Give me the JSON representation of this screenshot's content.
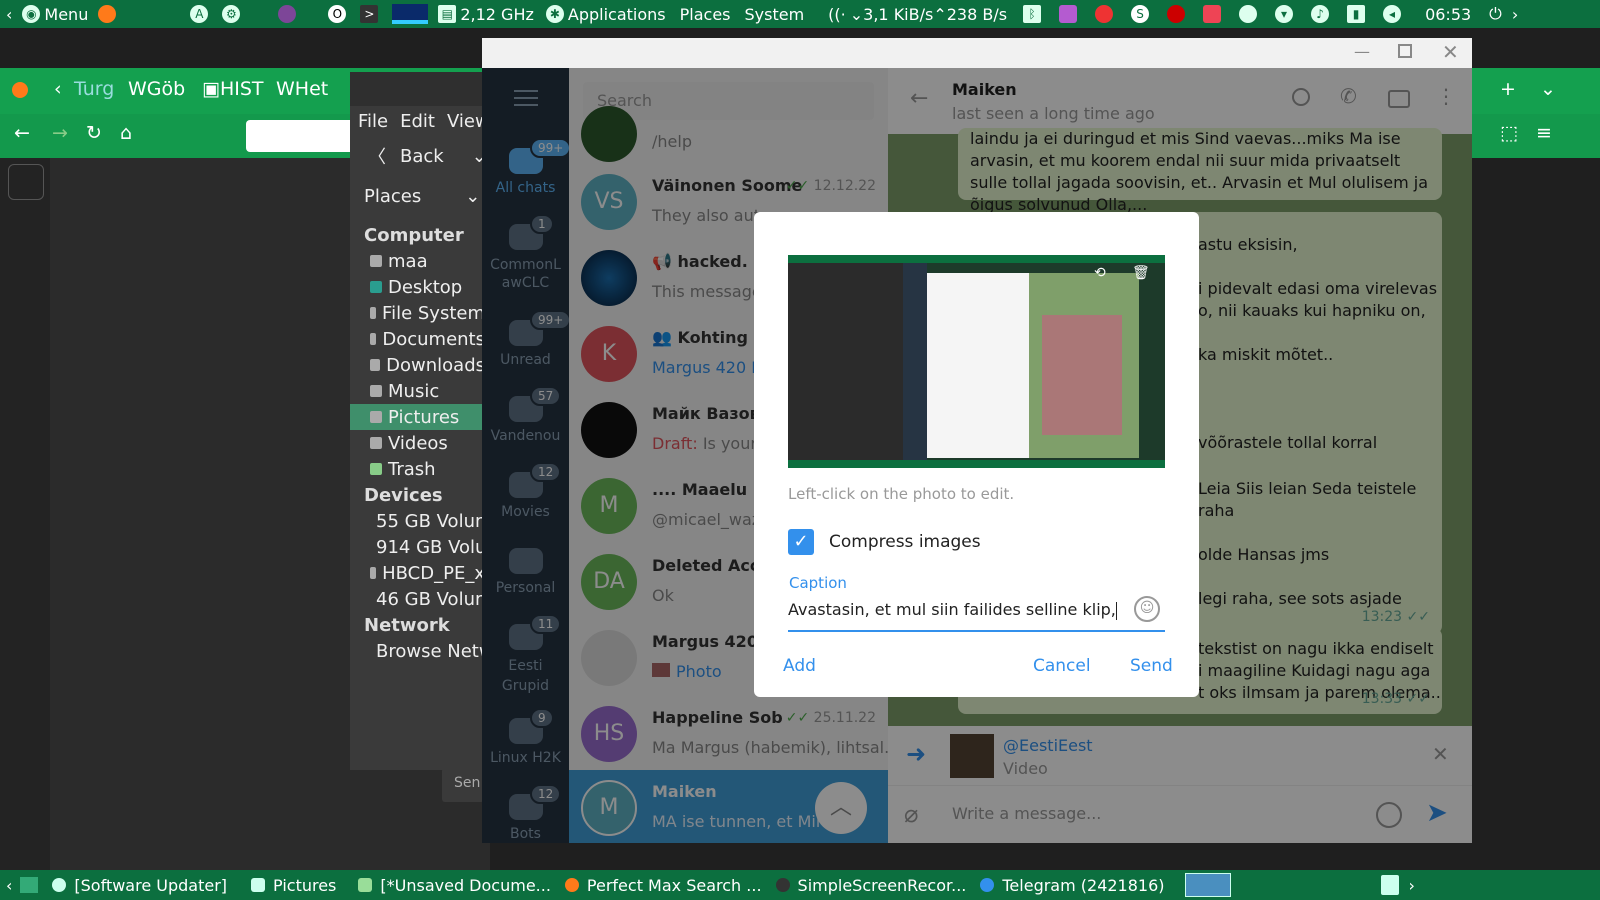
{
  "top_panel": {
    "menu_label": "Menu",
    "cpu_freq": "2,12 GHz",
    "applications": "Applications",
    "places": "Places",
    "system": "System",
    "net_down": "3,1 KiB/s",
    "net_up": "238 B/s",
    "clock": "06:53"
  },
  "firefox": {
    "tabs": [
      "Turg",
      "Göb",
      "HIST",
      "Het"
    ]
  },
  "file_manager": {
    "menu": [
      "File",
      "Edit",
      "View"
    ],
    "back_label": "Back",
    "places_label": "Places",
    "sections": [
      {
        "title": "Computer",
        "items": [
          "maa",
          "Desktop",
          "File System",
          "Documents",
          "Downloads",
          "Music",
          "Pictures",
          "Videos",
          "Trash"
        ]
      },
      {
        "title": "Devices",
        "items": [
          "55 GB Volume",
          "914 GB Volume",
          "HBCD_PE_x",
          "46 GB Volume"
        ]
      },
      {
        "title": "Network",
        "items": [
          "Browse Network"
        ]
      }
    ],
    "selected": "Pictures",
    "bottom_fragment": "Sen"
  },
  "telegram": {
    "search_placeholder": "Search",
    "folders": [
      {
        "label": "All chats",
        "badge": "99+"
      },
      {
        "label": "CommonLawCLC",
        "badge": "1"
      },
      {
        "label": "Unread",
        "badge": "99+"
      },
      {
        "label": "Vandenou",
        "badge": "57"
      },
      {
        "label": "Movies",
        "badge": "12"
      },
      {
        "label": "Personal",
        "badge": ""
      },
      {
        "label": "Eesti Grupid",
        "badge": "11"
      },
      {
        "label": "Linux H2K",
        "badge": "9"
      },
      {
        "label": "Bots",
        "badge": "12"
      }
    ],
    "chats": [
      {
        "initials": "",
        "name": "",
        "preview": "/help",
        "date": "",
        "color": "#2d5a2d"
      },
      {
        "initials": "VS",
        "name": "Väinonen Soome",
        "preview": "They also auto",
        "date": "12.12.22",
        "color": "#5fb3c5"
      },
      {
        "initials": "",
        "name": "hacked.",
        "preview": "This message",
        "date": "",
        "color": "#0b2a4a"
      },
      {
        "initials": "K",
        "name": "Kohting",
        "preview": "Margus 420 M",
        "date": "",
        "color": "#e0555d"
      },
      {
        "initials": "",
        "name": "Майк Вазовс",
        "preview": "Is your",
        "draft": "Draft:",
        "date": "",
        "color": "#222"
      },
      {
        "initials": "M",
        "name": ".... Maaelu",
        "preview": "@micael_waz",
        "date": "",
        "color": "#6cbb5c"
      },
      {
        "initials": "DA",
        "name": "Deleted Accou",
        "preview": "Ok",
        "date": "",
        "color": "#6cbb5c"
      },
      {
        "initials": "",
        "name": "Margus 420 M",
        "preview": "Photo",
        "date": "",
        "color": "#ddd"
      },
      {
        "initials": "HS",
        "name": "Happeline Sob",
        "preview": "Ma Margus (habemik), lihtsal...",
        "date": "25.11.22",
        "color": "#9a6ecf"
      },
      {
        "initials": "M",
        "name": "Maiken",
        "preview": "MA ise tunnen, et Ming",
        "date": "",
        "color": "#5fb3c5"
      }
    ],
    "chat_header": {
      "name": "Maiken",
      "status": "last seen a long time ago"
    },
    "messages": [
      "laindu ja ei duringud et mis Sind vaevas...miks Ma ise arvasin, et mu koorem endal nii suur mida privaatselt sulle tollal jagada soovisin, et.. Arvasin et Mul olulisem ja õigus solvunud Olla,...",
      "astu eksisin,",
      "i pidevalt edasi oma virelevas",
      "o, nii kauaks kui hapniku on,",
      "ka miskit mõtet..",
      "võõrastele tollal korral",
      "Leia Siis leian Seda teistele raha",
      "olde Hansas jms",
      "legi raha, see sots asjade",
      "tekstist on nagu ikka endiselt",
      "i maagiline Kuidagi nagu aga",
      "t oks ilmsam ja parem olema.."
    ],
    "msg_times": [
      "13:23",
      "13:33"
    ],
    "reply": {
      "from": "@EestiEest",
      "type": "Video"
    },
    "input_placeholder": "Write a message..."
  },
  "dialog": {
    "hint": "Left-click on the photo to edit.",
    "compress_label": "Compress images",
    "compress_checked": true,
    "caption_label": "Caption",
    "caption_value": "Avastasin, et mul siin failides selline klip,",
    "add": "Add",
    "cancel": "Cancel",
    "send": "Send"
  },
  "taskbar": [
    "[Software Updater]",
    "Pictures",
    "[*Unsaved Docume...",
    "Perfect Max Search ...",
    "SimpleScreenRecor...",
    "Telegram (2421816)"
  ],
  "colors": {
    "panel_green": "#0c6f3f",
    "firefox_green": "#14a04f",
    "telegram_blue": "#3390ec",
    "dialog_accent": "#3390ec"
  }
}
